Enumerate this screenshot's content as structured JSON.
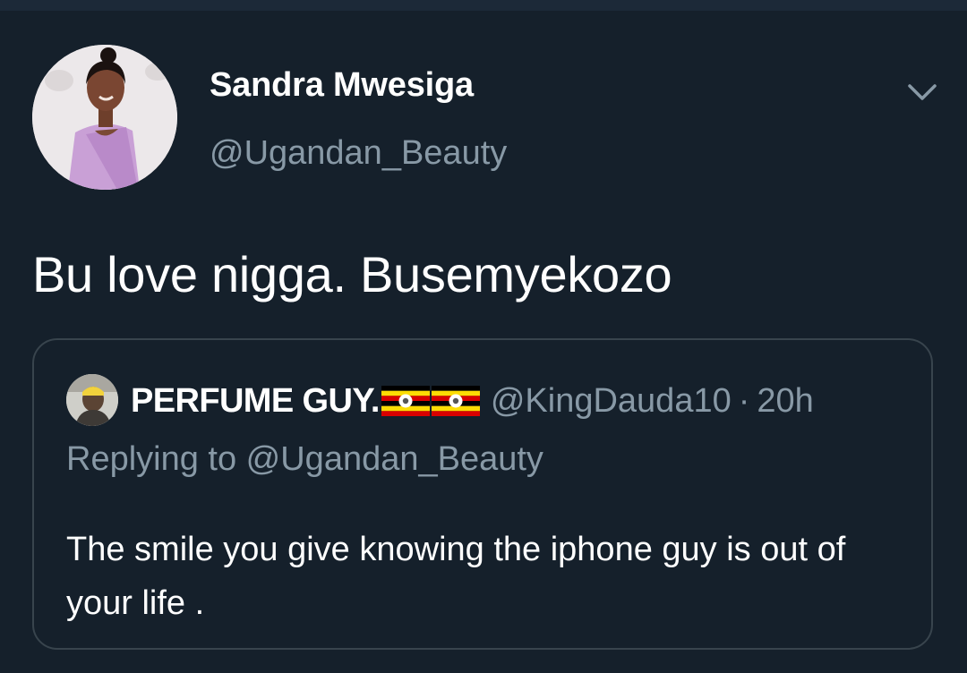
{
  "tweet": {
    "author_name": "Sandra Mwesiga",
    "author_handle": "@Ugandan_Beauty",
    "text": "Bu love nigga. Busemyekozo",
    "menu_icon": "chevron-down-icon"
  },
  "quoted_tweet": {
    "author_name": "PERFUME GUY.",
    "flag_icons": [
      "uganda-flag-icon",
      "uganda-flag-icon"
    ],
    "author_handle": "@KingDauda10",
    "separator": "·",
    "time": "20h",
    "replying_to": "Replying to @Ugandan_Beauty",
    "text": "The smile you give knowing the iphone guy is out of your life ."
  },
  "colors": {
    "background": "#15202b",
    "border": "#38444d",
    "secondary_text": "#8899a6",
    "primary_text": "#ffffff"
  }
}
